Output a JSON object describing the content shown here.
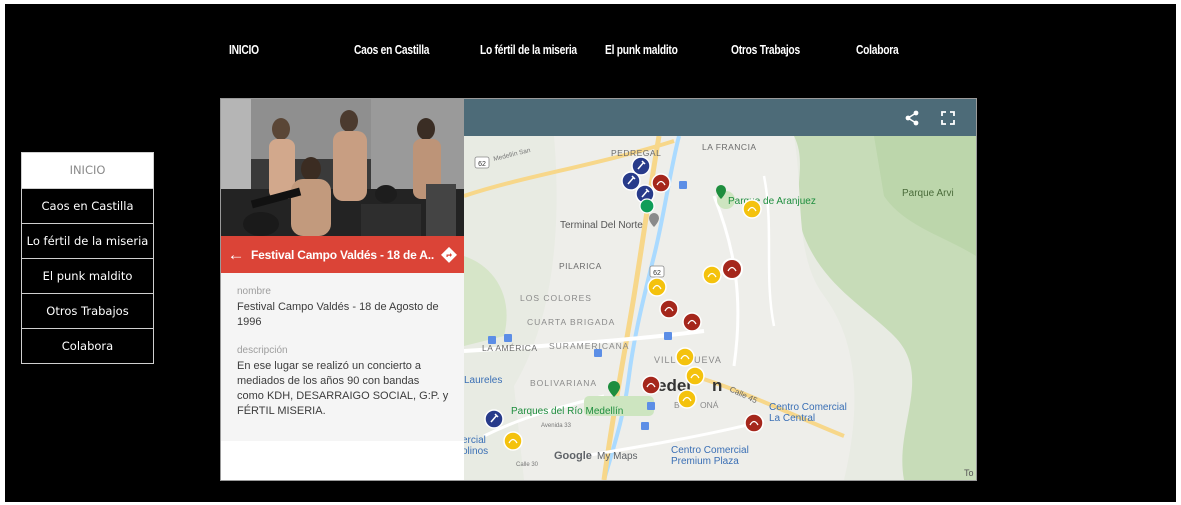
{
  "top_nav": [
    "INICIO",
    "Caos en Castilla",
    "Lo fértil de la miseria",
    "El punk maldito",
    "Otros Trabajos",
    "Colabora"
  ],
  "side_nav": [
    {
      "label": "INICIO",
      "active": true
    },
    {
      "label": "Caos en Castilla",
      "active": false
    },
    {
      "label": "Lo fértil de la miseria",
      "active": false
    },
    {
      "label": "El punk maldito",
      "active": false
    },
    {
      "label": "Otros Trabajos",
      "active": false
    },
    {
      "label": "Colabora",
      "active": false
    }
  ],
  "place_panel": {
    "title": "Festival Campo Valdés - 18 de A...",
    "name_label": "nombre",
    "name_value": "Festival Campo Valdés - 18 de Agosto de 1996",
    "description_label": "descripción",
    "description_value": "En ese lugar se realizó un concierto a mediados de los años 90 con bandas como KDH, DESARRAIGO SOCIAL, G:P. y FÉRTIL MISERIA.",
    "back_icon": "arrow-left-icon",
    "directions_icon": "directions-icon"
  },
  "map": {
    "header_icons": [
      "share-icon",
      "fullscreen-icon"
    ],
    "labels": {
      "pedregal": "PEDREGAL",
      "la_francia": "LA FRANCIA",
      "parque_aranjuez": "Parque de Aranjuez",
      "parque_arvi": "Parque Arvi",
      "terminal_norte": "Terminal Del Norte",
      "pilarica": "PILARICA",
      "los_colores": "LOS COLORES",
      "cuarta_brigada": "CUARTA BRIGADA",
      "la_america": "LA AMÉRICA",
      "suramericana": "SURAMERICANA",
      "villanueva_a": "VILL",
      "villanueva_b": "UEVA",
      "laureles": "Laureles",
      "bolivariana": "BOLIVARIANA",
      "medellin_a": "edel",
      "medellin_b": "n",
      "boston_a": "B",
      "boston_b": "ONÁ",
      "parques_rio": "Parques del Río Medellín",
      "centro_comercial_central": "Centro Comercial",
      "la_central": "La Central",
      "comercial_molinos_a": "ercial",
      "comercial_molinos_b": "olinos",
      "google": "Google",
      "my_maps": "My Maps",
      "centro_premium": "Centro Comercial",
      "premium_plaza": "Premium Plaza",
      "road_62": "62",
      "road_62b": "62",
      "medellin_san": "Medellín San",
      "calle_45": "Calle 45",
      "calle_30": "Calle 30",
      "avenida_33": "Avenida 33",
      "to": "To"
    },
    "colors": {
      "blue_pin": "#283b8a",
      "red_pin": "#a5271c",
      "yellow_pin": "#f4c20d",
      "green_pin": "#0f9d58",
      "header": "#4d6b78",
      "red_bar": "#db4437"
    }
  }
}
